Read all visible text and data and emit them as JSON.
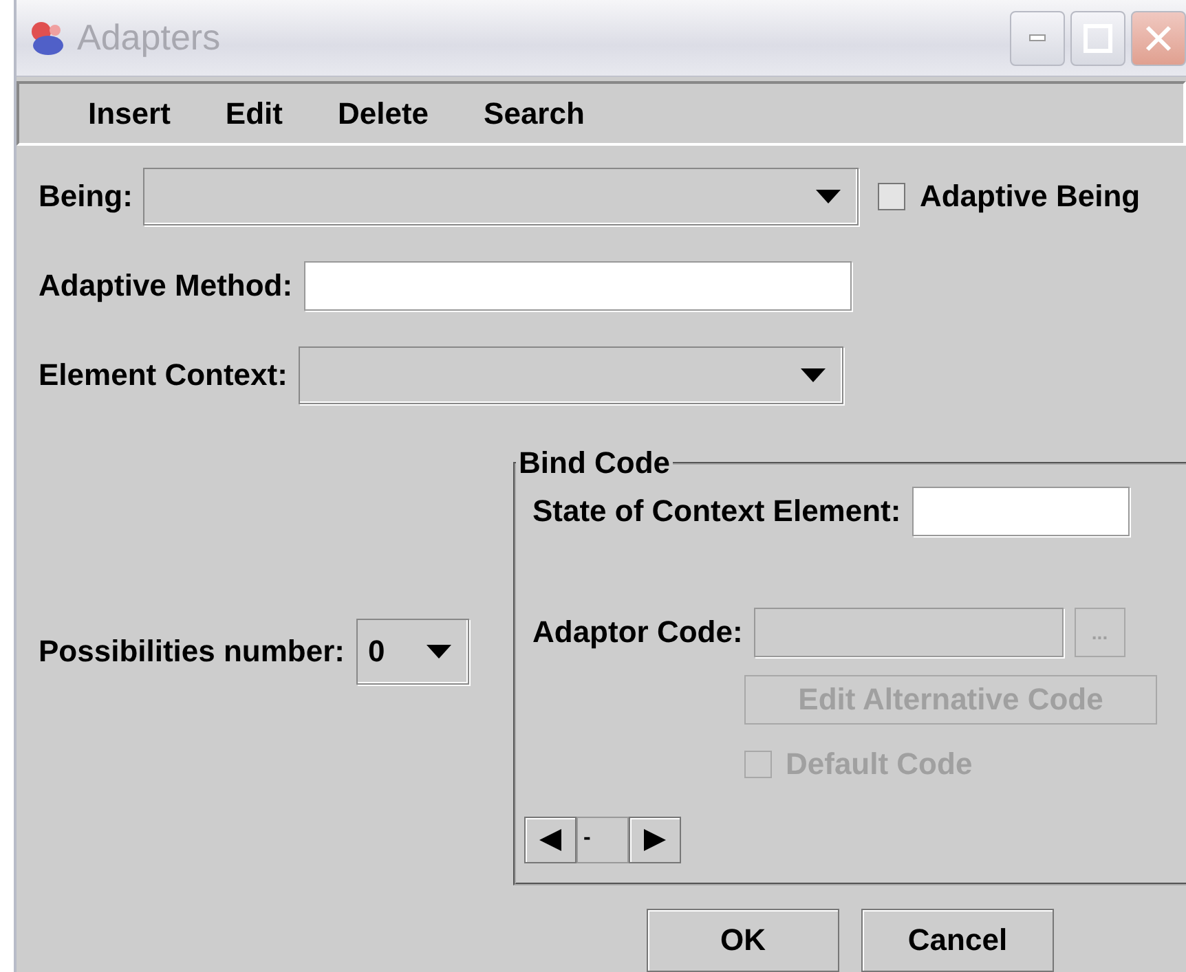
{
  "window": {
    "title": "Adapters"
  },
  "menu": [
    {
      "label": "Insert"
    },
    {
      "label": "Edit"
    },
    {
      "label": "Delete"
    },
    {
      "label": "Search"
    }
  ],
  "being": {
    "label": "Being:",
    "checkbox": {
      "label": "Adaptive Being",
      "checked": false
    }
  },
  "adaptive_method": {
    "label": "Adaptive Method:"
  },
  "element_context": {
    "label": "Element Context:"
  },
  "possibilities": {
    "label": "Possibilities number:",
    "value": "0"
  },
  "bind_code": {
    "title": "Bind Code",
    "state_label": "State of Context Element:",
    "adaptor_label": "Adaptor Code:",
    "adaptor_disabled": true,
    "browse": {
      "label": "...",
      "disabled": true
    },
    "edit_alternative": {
      "label": "Edit Alternative Code",
      "disabled": true
    },
    "default_code": {
      "label": "Default Code",
      "checked": false,
      "disabled": true
    },
    "navigator": {
      "value": "-"
    }
  },
  "buttons": [
    {
      "label": "OK"
    },
    {
      "label": "Cancel"
    }
  ]
}
